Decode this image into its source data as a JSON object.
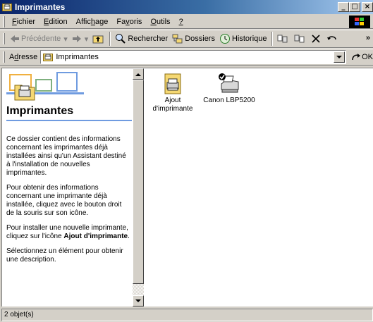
{
  "window": {
    "title": "Imprimantes",
    "minimize": "_",
    "maximize": "□",
    "close": "×"
  },
  "menu": [
    {
      "pre": "",
      "ul": "F",
      "post": "ichier"
    },
    {
      "pre": "",
      "ul": "E",
      "post": "dition"
    },
    {
      "pre": "Affic",
      "ul": "h",
      "post": "age"
    },
    {
      "pre": "Fa",
      "ul": "v",
      "post": "oris"
    },
    {
      "pre": "",
      "ul": "O",
      "post": "utils"
    },
    {
      "pre": "",
      "ul": "?",
      "post": ""
    }
  ],
  "toolbar": {
    "back": "Précédente",
    "search": "Rechercher",
    "folders": "Dossiers",
    "history": "Historique",
    "more": "»"
  },
  "address": {
    "label_pre": "A",
    "label_ul": "d",
    "label_post": "resse",
    "value": "Imprimantes",
    "go": "OK"
  },
  "left_pane": {
    "title": "Imprimantes",
    "para1": "Ce dossier contient des informations concernant les imprimantes déjà installées ainsi qu'un Assistant destiné à l'installation de nouvelles imprimantes.",
    "para2": "Pour obtenir des informations concernant une imprimante déjà installée, cliquez avec le bouton droit de la souris sur son icône.",
    "para3_prefix": "Pour installer une nouvelle imprimante, cliquez sur l'icône ",
    "para3_bold": "Ajout d'imprimante",
    "para3_suffix": ".",
    "para4": "Sélectionnez un élément pour obtenir une description."
  },
  "items": [
    {
      "label_line1": "Ajout",
      "label_line2": "d'imprimante",
      "icon": "add-printer-icon"
    },
    {
      "label_line1": "Canon LBP5200",
      "label_line2": "",
      "icon": "printer-icon"
    }
  ],
  "status": {
    "count": "2 objet(s)"
  }
}
